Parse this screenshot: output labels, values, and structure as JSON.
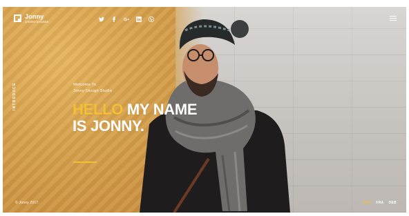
{
  "brand": {
    "name": "Jonny",
    "tagline": "creative template"
  },
  "header": {
    "socials": [
      {
        "icon": "twitter-icon"
      },
      {
        "icon": "facebook-icon"
      },
      {
        "icon": "google-plus-icon"
      },
      {
        "icon": "linkedin-icon"
      },
      {
        "icon": "pinterest-icon"
      }
    ],
    "menu_icon": "hamburger-menu-icon"
  },
  "side_label": "INTRODUCE",
  "hero": {
    "welcome_line1": "Welcome To",
    "welcome_line2": "Jonny Design Studio",
    "headline_yellow": "HELLO",
    "headline_white_1": " MY NAME",
    "headline_white_2": "IS JONNY."
  },
  "footer": {
    "copyright": "© Jonny 2017.",
    "languages": [
      {
        "label": "ENG",
        "active": true
      },
      {
        "label": "FRA",
        "active": false
      },
      {
        "label": "DEB",
        "active": false
      }
    ]
  },
  "colors": {
    "accent": "#f3c033",
    "text": "#ffffff"
  }
}
